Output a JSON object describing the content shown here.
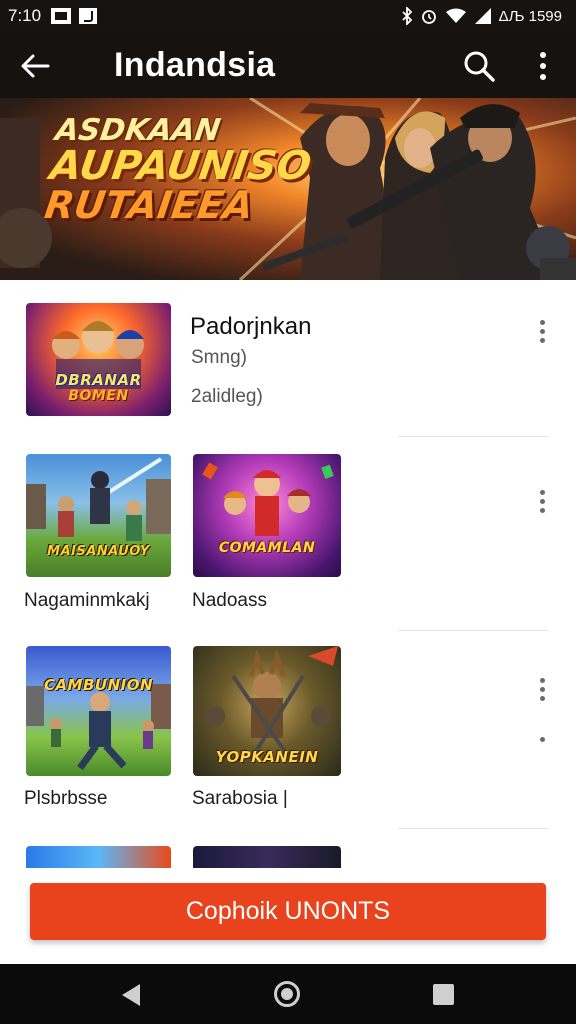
{
  "status_bar": {
    "time": "7:10",
    "battery_text": "ΔЉ 1599",
    "icons": [
      "image-icon",
      "music-icon",
      "bluetooth-icon",
      "alarm-icon",
      "wifi-icon",
      "signal-icon",
      "battery-icon"
    ]
  },
  "app_bar": {
    "title": "Indandsia",
    "icons": [
      "back-arrow-icon",
      "search-icon",
      "more-vert-icon"
    ]
  },
  "banner": {
    "title_lines": [
      "ASDKAAN",
      "AUPAUNISO",
      "RUTAIEEA"
    ]
  },
  "featured": {
    "title": "Padorjnkan",
    "subtitle": "Smng)",
    "meta": "2alidleg)",
    "thumb_text": [
      "DBRANAR",
      "BOMEN"
    ]
  },
  "grid": [
    {
      "caption": "Nagaminmkakj",
      "thumb_text": "MAISANAUOY"
    },
    {
      "caption": "Nadoass",
      "thumb_text": "COMAMLAN"
    },
    {
      "caption": "Plsbrbsse",
      "thumb_text": "CAMBUNION"
    },
    {
      "caption": "Sarabosia |",
      "thumb_text": "YOPKANEIN"
    }
  ],
  "action": {
    "button_label": "Cophoik UNONTS"
  },
  "colors": {
    "accent": "#e8431d",
    "app_bar": "#151210",
    "status_bar": "#161310",
    "nav_bar": "#0b0b0b"
  }
}
